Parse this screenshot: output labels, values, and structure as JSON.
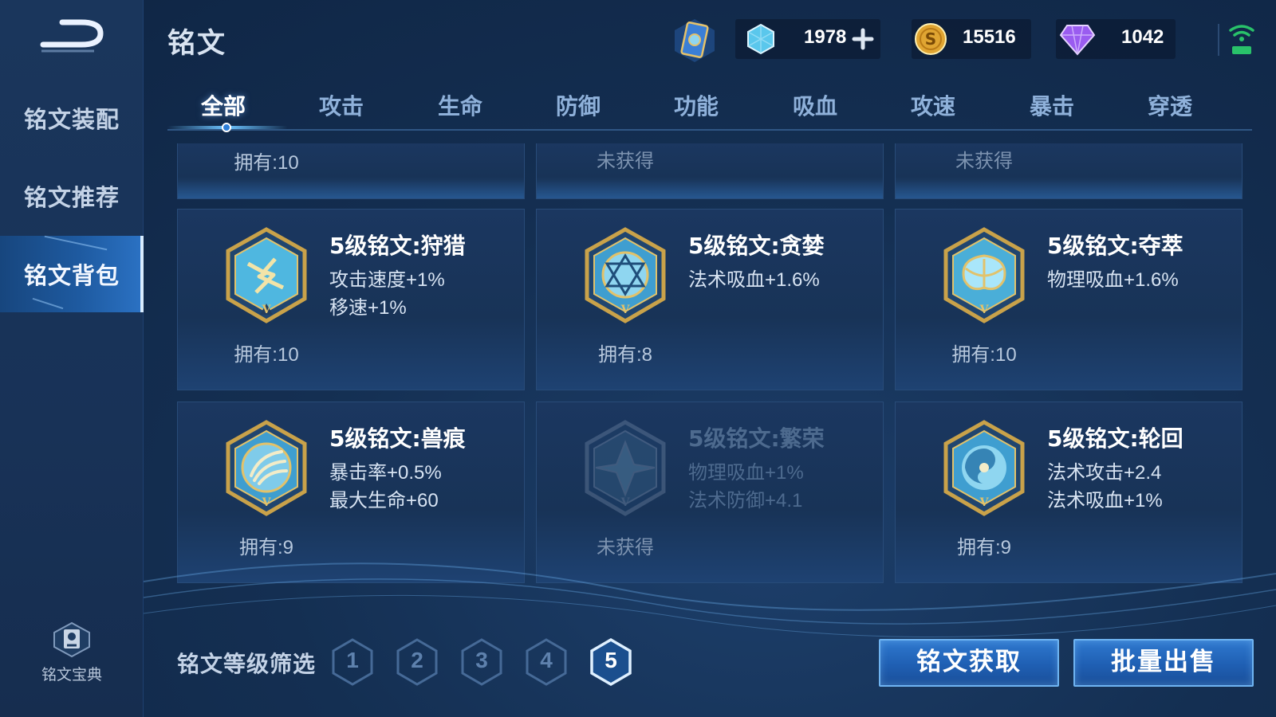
{
  "header": {
    "title": "铭文",
    "currencies": [
      {
        "icon": "diamond-coupon-icon",
        "value": "1978",
        "has_add": true
      },
      {
        "icon": "gold-coin-icon",
        "value": "15516"
      },
      {
        "icon": "purple-gem-icon",
        "value": "1042"
      }
    ]
  },
  "sidebar": {
    "items": [
      {
        "label": "铭文装配"
      },
      {
        "label": "铭文推荐"
      },
      {
        "label": "铭文背包",
        "active": true
      }
    ],
    "codex_label": "铭文宝典"
  },
  "tabs": [
    {
      "label": "全部",
      "active": true
    },
    {
      "label": "攻击"
    },
    {
      "label": "生命"
    },
    {
      "label": "防御"
    },
    {
      "label": "功能"
    },
    {
      "label": "吸血"
    },
    {
      "label": "攻速"
    },
    {
      "label": "暴击"
    },
    {
      "label": "穿透"
    }
  ],
  "top_row": [
    {
      "owned": "拥有:10"
    },
    {
      "owned": "未获得"
    },
    {
      "owned": "未获得"
    }
  ],
  "cards": [
    {
      "name": "5级铭文:狩猎",
      "stat1": "攻击速度+1%",
      "stat2": "移速+1%",
      "owned": "拥有:10",
      "obtained": true,
      "icon": "hunt-rune-icon"
    },
    {
      "name": "5级铭文:贪婪",
      "stat1": "法术吸血+1.6%",
      "stat2": "",
      "owned": "拥有:8",
      "obtained": true,
      "icon": "greed-rune-icon"
    },
    {
      "name": "5级铭文:夺萃",
      "stat1": "物理吸血+1.6%",
      "stat2": "",
      "owned": "拥有:10",
      "obtained": true,
      "icon": "plunder-rune-icon"
    },
    {
      "name": "5级铭文:兽痕",
      "stat1": "暴击率+0.5%",
      "stat2": "最大生命+60",
      "owned": "拥有:9",
      "obtained": true,
      "icon": "beast-mark-rune-icon"
    },
    {
      "name": "5级铭文:繁荣",
      "stat1": "物理吸血+1%",
      "stat2": "法术防御+4.1",
      "owned": "未获得",
      "obtained": false,
      "icon": "prosperity-rune-icon"
    },
    {
      "name": "5级铭文:轮回",
      "stat1": "法术攻击+2.4",
      "stat2": "法术吸血+1%",
      "owned": "拥有:9",
      "obtained": true,
      "icon": "reincarnation-rune-icon"
    }
  ],
  "filter": {
    "label": "铭文等级筛选",
    "levels": [
      "1",
      "2",
      "3",
      "4",
      "5"
    ],
    "selected": "5"
  },
  "buttons": {
    "obtain": "铭文获取",
    "bulk_sell": "批量出售"
  },
  "colors": {
    "accent": "#2f79cf",
    "background": "#142f52",
    "gold": "#c9a24a",
    "rune_blue": "#8fd6f0"
  }
}
